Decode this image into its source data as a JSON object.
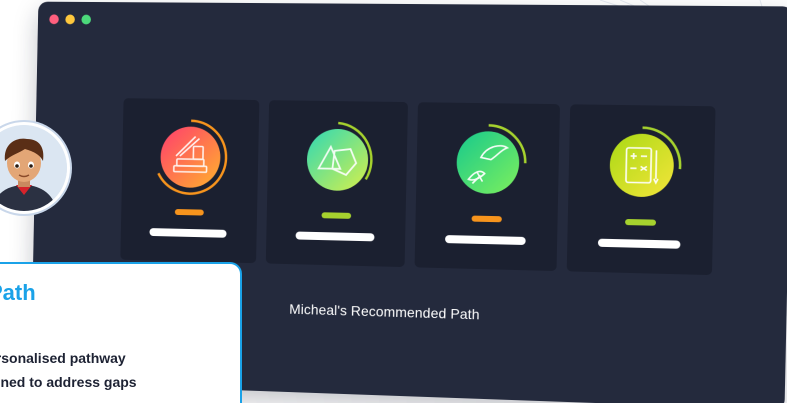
{
  "window": {
    "traffic_lights": [
      "#ff5f7e",
      "#ffc83d",
      "#4cd97b"
    ],
    "background": "#242a3d"
  },
  "path": {
    "title": "Micheal's Recommended Path",
    "cards": [
      {
        "icon": "literacy-books-icon",
        "accent": "#f7941d",
        "colors": [
          "#ff3d6e",
          "#ffb22c"
        ]
      },
      {
        "icon": "shapes-geometry-icon",
        "accent": "#a6d22e",
        "colors": [
          "#2ed8b6",
          "#d7f04a"
        ]
      },
      {
        "icon": "nature-science-icon",
        "accent": "#f7941d",
        "colors": [
          "#16c98d",
          "#7ef05c"
        ]
      },
      {
        "icon": "math-calculator-icon",
        "accent": "#a6d22e",
        "colors": [
          "#a9d915",
          "#f4e53a"
        ]
      }
    ]
  },
  "avatar": {
    "icon": "student-avatar-icon"
  },
  "info": {
    "title": "Path",
    "lines": [
      "ersonalised pathway",
      "igned to address gaps"
    ]
  }
}
